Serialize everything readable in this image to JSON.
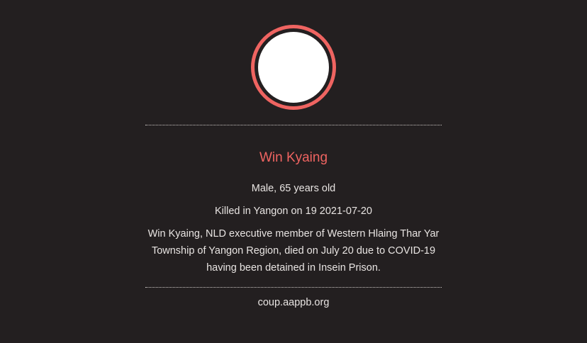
{
  "profile": {
    "name": "Win Kyaing",
    "gender_age": "Male, 65 years old",
    "killed": "Killed in Yangon on 19 2021-07-20",
    "description": "Win Kyaing, NLD executive member of Western Hlaing Thar Yar Township of Yangon Region, died on July 20 due to COVID-19 having been detained in Insein Prison."
  },
  "footer": {
    "source": "coup.aappb.org"
  },
  "colors": {
    "background": "#231f20",
    "accent": "#ef6461",
    "text": "#e8e4e2",
    "photo_placeholder": "#ffffff"
  }
}
